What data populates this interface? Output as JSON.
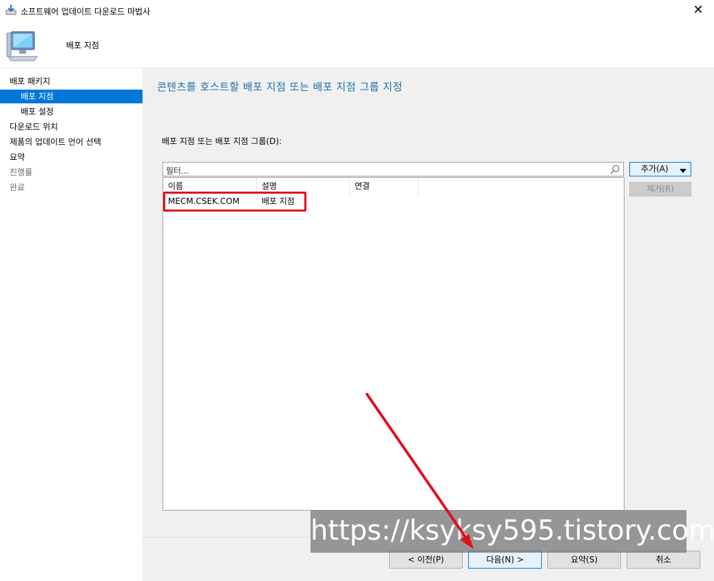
{
  "window": {
    "title": "소프트웨어 업데이트 다운로드 마법사",
    "close_glyph": "✕"
  },
  "header": {
    "title": "배포 지점"
  },
  "nav": {
    "items": [
      {
        "label": "배포 패키지"
      },
      {
        "label": "배포 지점"
      },
      {
        "label": "배포 설정"
      },
      {
        "label": "다운로드 위치"
      },
      {
        "label": "제품의 업데이트 언어 선택"
      },
      {
        "label": "요약"
      },
      {
        "label": "진행률"
      },
      {
        "label": "완료"
      }
    ]
  },
  "main": {
    "heading": "콘텐츠를 호스트할 배포 지점 또는 배포 지점 그룹 지정",
    "list_label": "배포 지점 또는 배포 지점 그룹(D):",
    "filter_placeholder": "필터...",
    "columns": [
      "이름",
      "설명",
      "연결"
    ],
    "rows": [
      {
        "name": "MECM.CSEK.COM",
        "description": "배포 지점",
        "connection": ""
      }
    ],
    "add_button": "추가(A)",
    "remove_button": "제거(R)"
  },
  "footer": {
    "prev_button": "< 이전(P)",
    "next_button": "다음(N) >",
    "summary_button": "요약(S)",
    "cancel_button": "취소"
  },
  "watermark": "https://ksyksy595.tistory.com",
  "colors": {
    "accent": "#0078d7",
    "heading": "#1c6ea4",
    "annotation": "#e0101d"
  }
}
